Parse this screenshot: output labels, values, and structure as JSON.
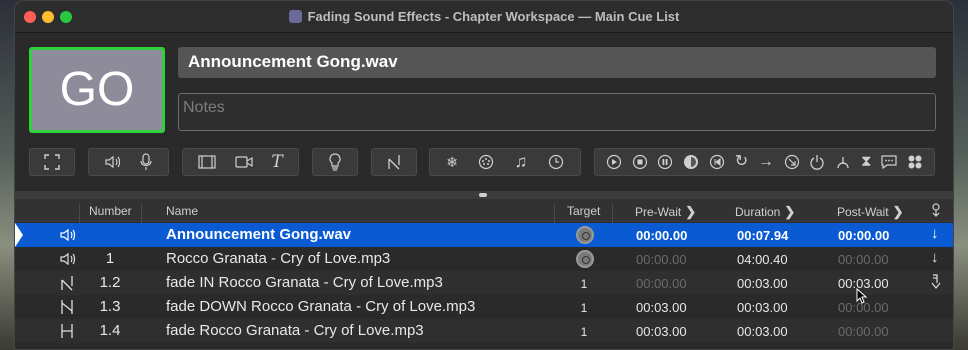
{
  "window": {
    "title": "Fading Sound Effects - Chapter Workspace — Main Cue List"
  },
  "header": {
    "go_label": "GO",
    "cue_name": "Announcement Gong.wav",
    "notes_placeholder": "Notes"
  },
  "toolbar": {
    "groups": [
      {
        "icons": [
          "fullscreen-icon"
        ]
      },
      {
        "icons": [
          "audio-icon",
          "mic-icon"
        ]
      },
      {
        "icons": [
          "video-icon",
          "camera-icon",
          "text-icon"
        ]
      },
      {
        "icons": [
          "light-icon"
        ]
      },
      {
        "icons": [
          "fade-icon"
        ]
      },
      {
        "icons": [
          "network-icon",
          "midi-icon",
          "music-icon",
          "timecode-icon"
        ]
      },
      {
        "icons": [
          "start-icon",
          "stop-icon",
          "pause-icon",
          "load-icon",
          "reset-icon",
          "goto-icon",
          "target-icon",
          "arm-icon",
          "devamp-icon",
          "disarm-icon",
          "wait-icon",
          "memo-icon",
          "group-icon"
        ]
      }
    ]
  },
  "table": {
    "columns": {
      "number": "Number",
      "name": "Name",
      "target": "Target",
      "prewait": "Pre-Wait",
      "duration": "Duration",
      "postwait": "Post-Wait"
    },
    "rows": [
      {
        "type": "audio",
        "number": "",
        "name": "Announcement Gong.wav",
        "target": "",
        "prewait": "00:00.00",
        "duration": "00:07.94",
        "postwait": "00:00.00",
        "continue": "auto-continue",
        "selected": true
      },
      {
        "type": "audio",
        "number": "1",
        "name": "Rocco Granata - Cry of Love.mp3",
        "target": "",
        "prewait": "00:00.00",
        "duration": "04:00.40",
        "postwait": "00:00.00",
        "continue": "auto-continue",
        "selected": false
      },
      {
        "type": "fade",
        "number": "1.2",
        "name": "fade IN Rocco Granata - Cry of Love.mp3",
        "target": "1",
        "prewait": "00:00.00",
        "duration": "00:03.00",
        "postwait": "00:03.00",
        "continue": "auto-follow",
        "selected": false
      },
      {
        "type": "fade",
        "number": "1.3",
        "name": "fade DOWN Rocco Granata - Cry of Love.mp3",
        "target": "1",
        "prewait": "00:03.00",
        "duration": "00:03.00",
        "postwait": "00:00.00",
        "continue": "",
        "selected": false
      },
      {
        "type": "fade",
        "number": "1.4",
        "name": "fade Rocco Granata - Cry of Love.mp3",
        "target": "1",
        "prewait": "00:03.00",
        "duration": "00:03.00",
        "postwait": "00:00.00",
        "continue": "",
        "selected": false
      }
    ]
  }
}
